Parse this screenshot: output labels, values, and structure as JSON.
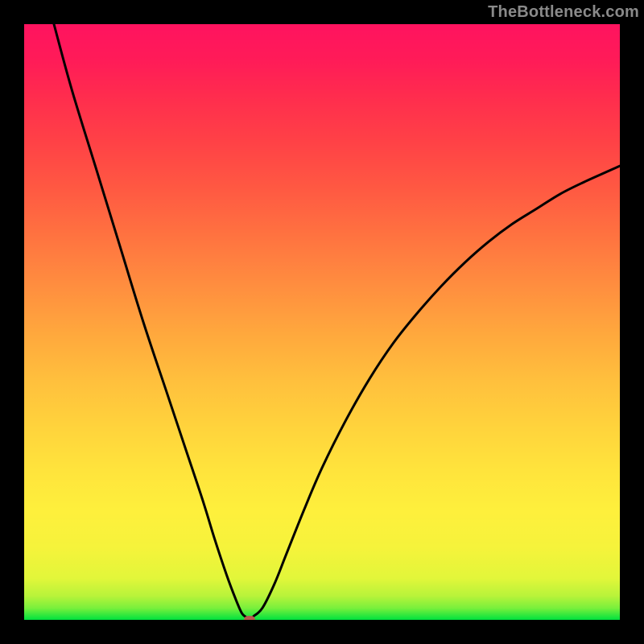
{
  "watermark": "TheBottleneck.com",
  "chart_data": {
    "type": "line",
    "title": "",
    "xlabel": "",
    "ylabel": "",
    "xlim": [
      0,
      100
    ],
    "ylim": [
      0,
      100
    ],
    "series": [
      {
        "name": "curve-left",
        "x": [
          5,
          8,
          12,
          16,
          20,
          24,
          27,
          30,
          32,
          34,
          35.5,
          36.5,
          37.2
        ],
        "y": [
          100,
          89,
          76,
          63,
          50,
          38,
          29,
          20,
          13.5,
          7.5,
          3.5,
          1.2,
          0.5
        ]
      },
      {
        "name": "curve-right",
        "x": [
          38.5,
          40,
          42,
          44,
          47,
          50,
          54,
          58,
          62,
          66,
          70,
          74,
          78,
          82,
          86,
          90,
          94,
          98,
          100
        ],
        "y": [
          0.6,
          2.0,
          6.0,
          11.0,
          18.5,
          25.5,
          33.5,
          40.5,
          46.5,
          51.5,
          56.0,
          60.0,
          63.5,
          66.5,
          69.0,
          71.5,
          73.5,
          75.3,
          76.2
        ]
      }
    ],
    "minimum_marker": {
      "x": 37.8,
      "y": 0.0
    }
  }
}
